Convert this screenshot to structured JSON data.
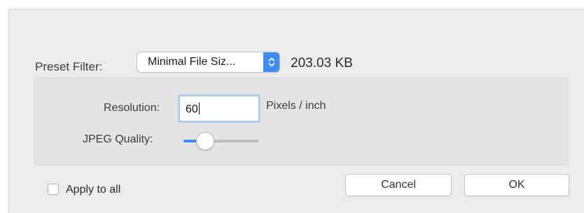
{
  "preset": {
    "label": "Preset Filter:",
    "selected": "Minimal File Siz...",
    "file_size": "203.03 KB"
  },
  "resolution": {
    "label": "Resolution:",
    "value": "60",
    "unit": "Pixels / inch"
  },
  "jpeg": {
    "label": "JPEG Quality:",
    "quality_fraction": 0.22
  },
  "apply_to_all": {
    "label": "Apply to all",
    "checked": false
  },
  "buttons": {
    "cancel": "Cancel",
    "ok": "OK"
  },
  "colors": {
    "accent": "#3c8ef6",
    "dialog_bg": "#ececec",
    "panel_bg": "#e4e4e4"
  },
  "icons": {
    "popup": "up-down-chevron-icon"
  }
}
